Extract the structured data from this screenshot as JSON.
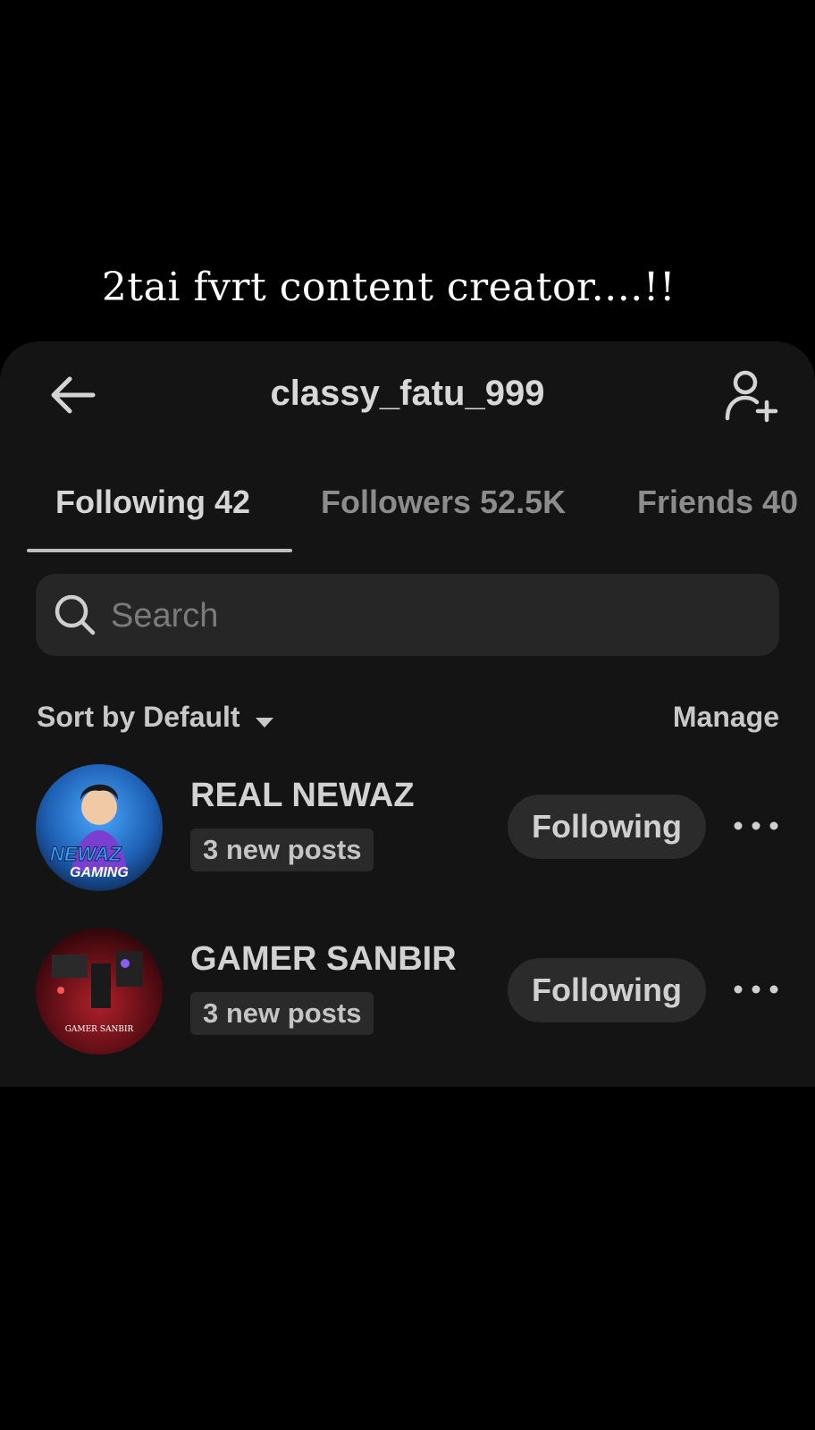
{
  "caption": "2tai fvrt content creator....!!",
  "header": {
    "title": "classy_fatu_999",
    "back_icon": "arrow-left-icon",
    "add_icon": "person-add-icon"
  },
  "tabs": [
    {
      "label": "Following 42",
      "active": true
    },
    {
      "label": "Followers 52.5K",
      "active": false
    },
    {
      "label": "Friends 40",
      "active": false
    }
  ],
  "search": {
    "placeholder": "Search",
    "icon": "search-icon"
  },
  "sort": {
    "label": "Sort by Default",
    "icon": "caret-down-icon"
  },
  "manage_label": "Manage",
  "users": [
    {
      "name": "REAL NEWAZ",
      "badge": "3 new posts",
      "button_label": "Following",
      "avatar_text_1": "NEWAZ",
      "avatar_text_2": "GAMING"
    },
    {
      "name": "GAMER SANBIR",
      "badge": "3 new posts",
      "button_label": "Following",
      "avatar_text_1": "GAMER SANBIR"
    }
  ],
  "colors": {
    "background": "#000000",
    "panel": "#141414",
    "chip": "#2b2b2b",
    "text": "#d2d2d2"
  }
}
